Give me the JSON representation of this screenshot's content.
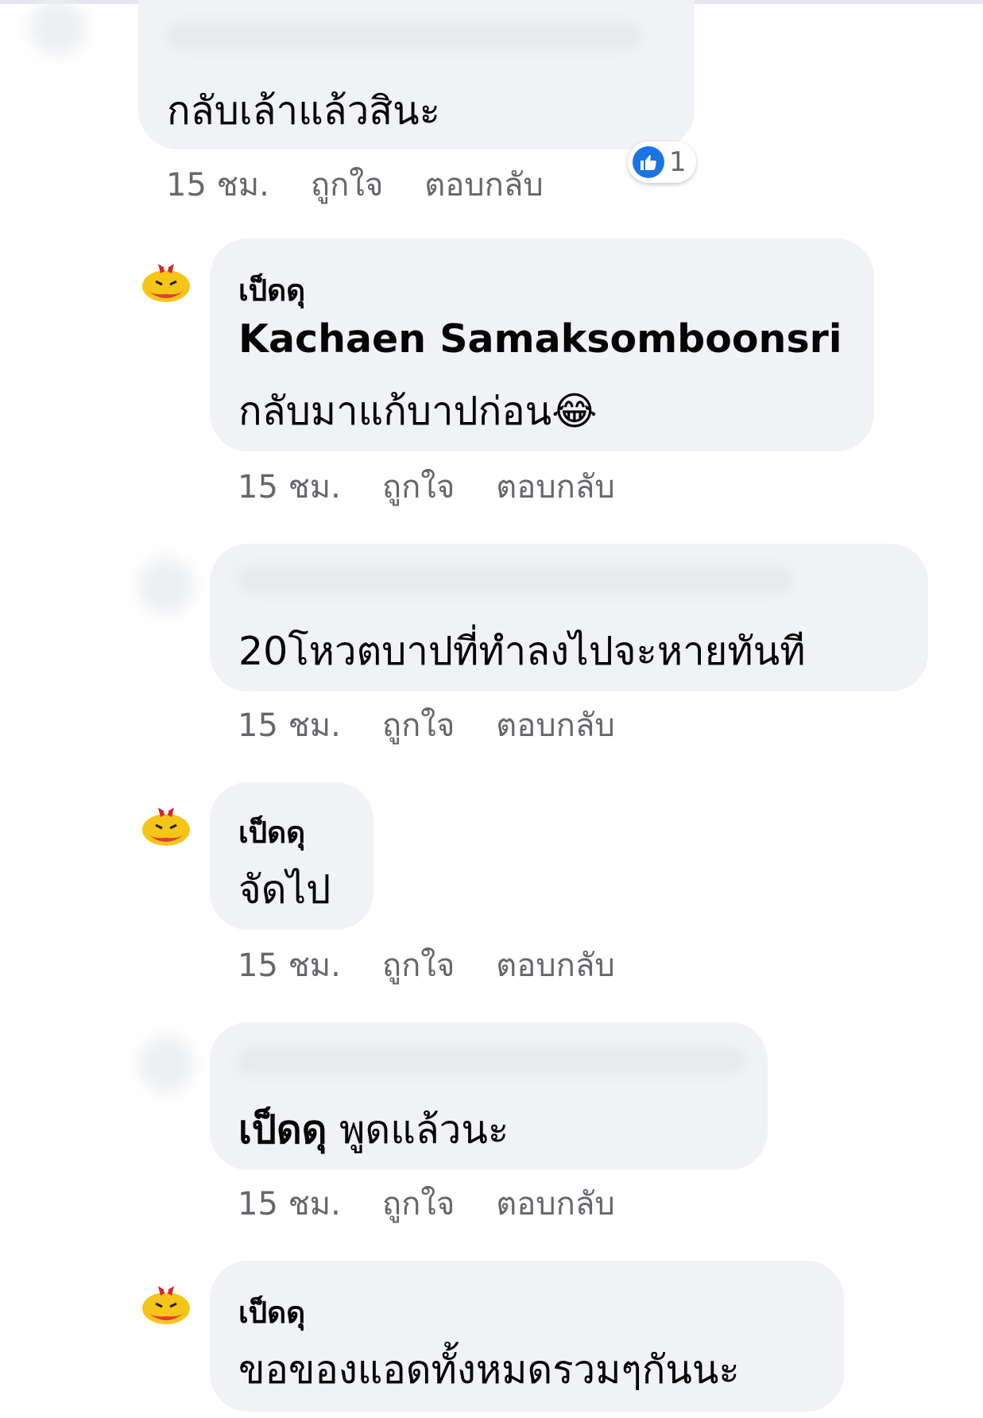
{
  "comments": [
    {
      "author": "",
      "author_hidden": true,
      "text": "กลับเล้าแล้วสินะ",
      "time": "15 ชม.",
      "like_label": "ถูกใจ",
      "reply_label": "ตอบกลับ",
      "reactions": {
        "icon": "thumbs-up-icon",
        "count": "1",
        "color": "#1b74e4"
      }
    },
    {
      "author": "เป็ดดุ",
      "mention": "Kachaen Samaksomboonsri",
      "text": "กลับมาแก้บาปก่อน",
      "emoji": "😂",
      "time": "15 ชม.",
      "like_label": "ถูกใจ",
      "reply_label": "ตอบกลับ"
    },
    {
      "author": "",
      "author_hidden": true,
      "text": "20โหวตบาปที่ทำลงไปจะหายทันที",
      "time": "15 ชม.",
      "like_label": "ถูกใจ",
      "reply_label": "ตอบกลับ"
    },
    {
      "author": "เป็ดดุ",
      "text": "จัดไป",
      "time": "15 ชม.",
      "like_label": "ถูกใจ",
      "reply_label": "ตอบกลับ"
    },
    {
      "author": "",
      "author_hidden": true,
      "mention": "เป็ดดุ",
      "text": "พูดแล้วนะ",
      "time": "15 ชม.",
      "like_label": "ถูกใจ",
      "reply_label": "ตอบกลับ"
    },
    {
      "author": "เป็ดดุ",
      "text": "ขอของแอดทั้งหมดรวมๆกันนะ"
    }
  ],
  "colors": {
    "bubble": "#f0f2f5",
    "meta_text": "#65676b",
    "like_blue": "#1b74e4"
  }
}
